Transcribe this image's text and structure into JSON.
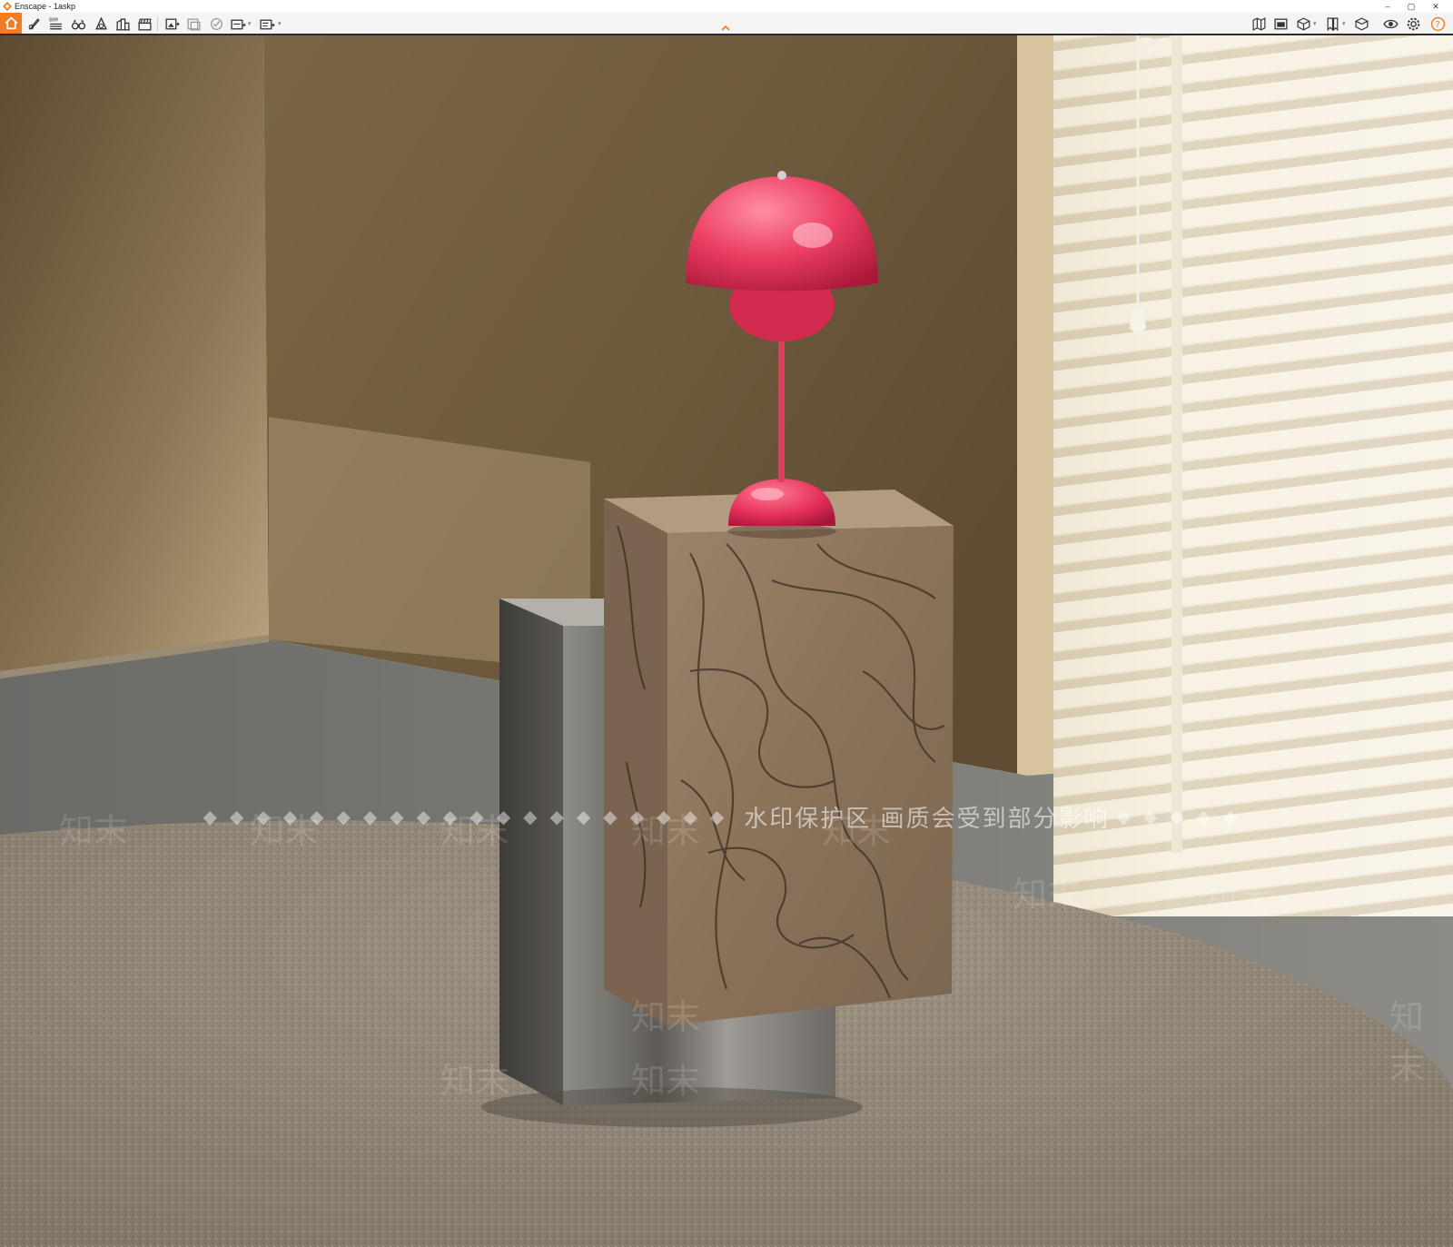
{
  "window": {
    "title": "Enscape - 1askp",
    "controls": {
      "minimize": "–",
      "maximize": "▢",
      "close": "✕"
    }
  },
  "toolbar": {
    "left_tools": [
      "home-icon",
      "paint-brush-icon",
      "bim-icon",
      "binoculars-icon",
      "water-drop-icon",
      "assets-library-icon",
      "clapperboard-icon",
      "render-image-icon",
      "batch-render-icon",
      "vr-headset-icon",
      "export-panorama-icon",
      "export-exe-icon"
    ],
    "bim_label": "BIM",
    "right_tools": [
      "map-view-icon",
      "window-panel-icon",
      "cube-view-icon",
      "bookmarks-icon",
      "material-editor-icon",
      "visibility-icon",
      "settings-icon",
      "help-icon"
    ],
    "accent_color": "#f47b20"
  },
  "viewport": {
    "scene": "enscape-render",
    "watermark": {
      "text": "水印保护区   画质会受到部分影响",
      "diamonds": "◆◆◆◆◆◆◆◆◆◆◆◆◆◆◆◆◆◆◆◆",
      "diamonds_right": "◆◆◆◆◆",
      "repeat_mark": "知末"
    }
  }
}
